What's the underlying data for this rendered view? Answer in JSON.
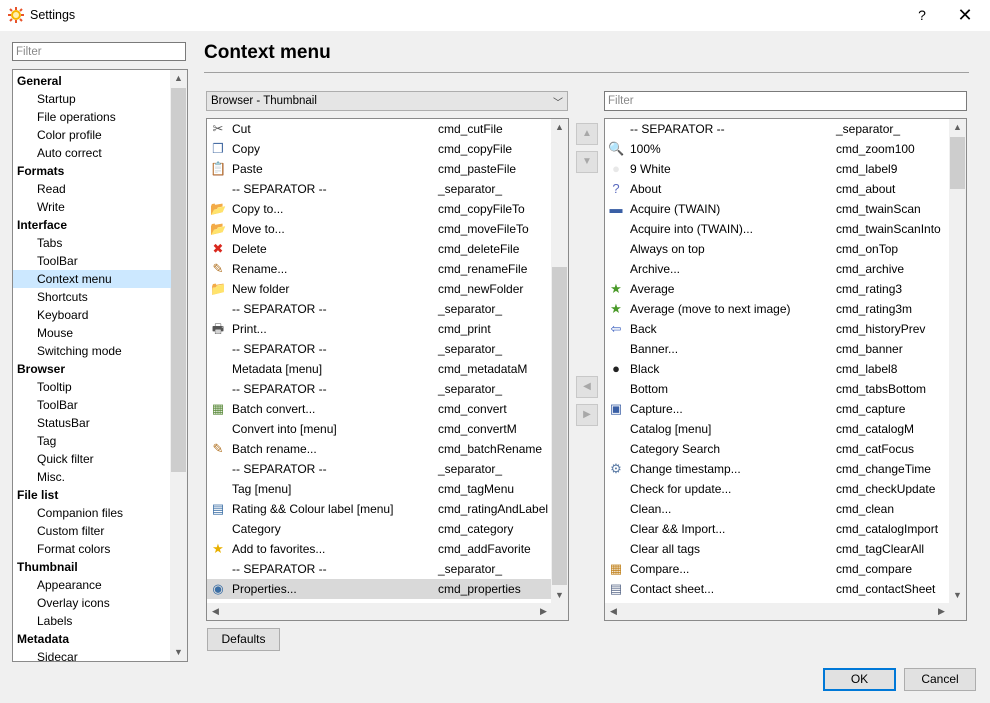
{
  "window": {
    "title": "Settings",
    "help_label": "?",
    "close_label": "✕"
  },
  "sidebar": {
    "filter_placeholder": "Filter",
    "groups": [
      {
        "label": "General",
        "items": [
          "Startup",
          "File operations",
          "Color profile",
          "Auto correct"
        ]
      },
      {
        "label": "Formats",
        "items": [
          "Read",
          "Write"
        ]
      },
      {
        "label": "Interface",
        "items": [
          "Tabs",
          "ToolBar",
          "Context menu",
          "Shortcuts",
          "Keyboard",
          "Mouse",
          "Switching mode"
        ]
      },
      {
        "label": "Browser",
        "items": [
          "Tooltip",
          "ToolBar",
          "StatusBar",
          "Tag",
          "Quick filter",
          "Misc."
        ]
      },
      {
        "label": "File list",
        "items": [
          "Companion files",
          "Custom filter",
          "Format colors"
        ]
      },
      {
        "label": "Thumbnail",
        "items": [
          "Appearance",
          "Overlay icons",
          "Labels"
        ]
      },
      {
        "label": "Metadata",
        "items": [
          "Sidecar"
        ]
      }
    ],
    "selected": "Context menu"
  },
  "main": {
    "heading": "Context menu",
    "menu_select": {
      "value": "Browser - Thumbnail"
    },
    "right_filter_placeholder": "Filter",
    "current_items": [
      {
        "icon": "scissors-icon",
        "glyph": "✂",
        "color": "#555555",
        "name": "Cut",
        "cmd": "cmd_cutFile"
      },
      {
        "icon": "copy-icon",
        "glyph": "❐",
        "color": "#4a6fa5",
        "name": "Copy",
        "cmd": "cmd_copyFile"
      },
      {
        "icon": "paste-icon",
        "glyph": "📋",
        "color": "#8a6d3b",
        "name": "Paste",
        "cmd": "cmd_pasteFile"
      },
      {
        "icon": "",
        "glyph": "",
        "color": "",
        "name": "-- SEPARATOR --",
        "cmd": "_separator_"
      },
      {
        "icon": "copy-to-folder-icon",
        "glyph": "📂",
        "color": "#d4a017",
        "name": "Copy to...",
        "cmd": "cmd_copyFileTo"
      },
      {
        "icon": "move-to-folder-icon",
        "glyph": "📂",
        "color": "#d4a017",
        "name": "Move to...",
        "cmd": "cmd_moveFileTo"
      },
      {
        "icon": "delete-icon",
        "glyph": "✖",
        "color": "#d9281e",
        "name": "Delete",
        "cmd": "cmd_deleteFile"
      },
      {
        "icon": "rename-icon",
        "glyph": "✎",
        "color": "#b07020",
        "name": "Rename...",
        "cmd": "cmd_renameFile"
      },
      {
        "icon": "new-folder-icon",
        "glyph": "📁",
        "color": "#e0b020",
        "name": "New folder",
        "cmd": "cmd_newFolder"
      },
      {
        "icon": "",
        "glyph": "",
        "color": "",
        "name": "-- SEPARATOR --",
        "cmd": "_separator_"
      },
      {
        "icon": "print-icon",
        "glyph": "🖶",
        "color": "#555555",
        "name": "Print...",
        "cmd": "cmd_print"
      },
      {
        "icon": "",
        "glyph": "",
        "color": "",
        "name": "-- SEPARATOR --",
        "cmd": "_separator_"
      },
      {
        "icon": "",
        "glyph": "",
        "color": "",
        "name": "Metadata [menu]",
        "cmd": "cmd_metadataM"
      },
      {
        "icon": "",
        "glyph": "",
        "color": "",
        "name": "-- SEPARATOR --",
        "cmd": "_separator_"
      },
      {
        "icon": "batch-convert-icon",
        "glyph": "▦",
        "color": "#5a8a3a",
        "name": "Batch convert...",
        "cmd": "cmd_convert"
      },
      {
        "icon": "",
        "glyph": "",
        "color": "",
        "name": "Convert into [menu]",
        "cmd": "cmd_convertM"
      },
      {
        "icon": "batch-rename-icon",
        "glyph": "✎",
        "color": "#b07020",
        "name": "Batch rename...",
        "cmd": "cmd_batchRename"
      },
      {
        "icon": "",
        "glyph": "",
        "color": "",
        "name": "-- SEPARATOR --",
        "cmd": "_separator_"
      },
      {
        "icon": "",
        "glyph": "",
        "color": "",
        "name": "Tag [menu]",
        "cmd": "cmd_tagMenu"
      },
      {
        "icon": "rating-icon",
        "glyph": "▤",
        "color": "#3a6ea5",
        "name": "Rating && Colour label [menu]",
        "cmd": "cmd_ratingAndLabel"
      },
      {
        "icon": "",
        "glyph": "",
        "color": "",
        "name": "Category",
        "cmd": "cmd_category"
      },
      {
        "icon": "star-icon",
        "glyph": "★",
        "color": "#e8b000",
        "name": "Add to favorites...",
        "cmd": "cmd_addFavorite"
      },
      {
        "icon": "",
        "glyph": "",
        "color": "",
        "name": "-- SEPARATOR --",
        "cmd": "_separator_"
      },
      {
        "icon": "properties-icon",
        "glyph": "◉",
        "color": "#3a6ea5",
        "name": "Properties...",
        "cmd": "cmd_properties"
      }
    ],
    "selected_current": "Properties...",
    "available_items": [
      {
        "icon": "",
        "glyph": "",
        "color": "",
        "name": "-- SEPARATOR --",
        "cmd": "_separator_"
      },
      {
        "icon": "zoom-icon",
        "glyph": "🔍",
        "color": "#4a6fa5",
        "name": "100%",
        "cmd": "cmd_zoom100"
      },
      {
        "icon": "white-circle-icon",
        "glyph": "●",
        "color": "#e8e8e8",
        "name": "9 White",
        "cmd": "cmd_label9"
      },
      {
        "icon": "about-icon",
        "glyph": "?",
        "color": "#5b6bbf",
        "name": "About",
        "cmd": "cmd_about"
      },
      {
        "icon": "scanner-icon",
        "glyph": "▬",
        "color": "#3a5fa5",
        "name": "Acquire (TWAIN)",
        "cmd": "cmd_twainScan"
      },
      {
        "icon": "",
        "glyph": "",
        "color": "",
        "name": "Acquire into (TWAIN)...",
        "cmd": "cmd_twainScanInto"
      },
      {
        "icon": "",
        "glyph": "",
        "color": "",
        "name": "Always on top",
        "cmd": "cmd_onTop"
      },
      {
        "icon": "",
        "glyph": "",
        "color": "",
        "name": "Archive...",
        "cmd": "cmd_archive"
      },
      {
        "icon": "star-green-icon",
        "glyph": "★",
        "color": "#4a9a2a",
        "name": "Average",
        "cmd": "cmd_rating3"
      },
      {
        "icon": "star-green-arrow-icon",
        "glyph": "★",
        "color": "#4a9a2a",
        "name": "Average (move to next image)",
        "cmd": "cmd_rating3m"
      },
      {
        "icon": "back-icon",
        "glyph": "⇦",
        "color": "#3a5fbf",
        "name": "Back",
        "cmd": "cmd_historyPrev"
      },
      {
        "icon": "",
        "glyph": "",
        "color": "",
        "name": "Banner...",
        "cmd": "cmd_banner"
      },
      {
        "icon": "black-circle-icon",
        "glyph": "●",
        "color": "#222222",
        "name": "Black",
        "cmd": "cmd_label8"
      },
      {
        "icon": "",
        "glyph": "",
        "color": "",
        "name": "Bottom",
        "cmd": "cmd_tabsBottom"
      },
      {
        "icon": "camera-icon",
        "glyph": "▣",
        "color": "#3a5fa5",
        "name": "Capture...",
        "cmd": "cmd_capture"
      },
      {
        "icon": "",
        "glyph": "",
        "color": "",
        "name": "Catalog [menu]",
        "cmd": "cmd_catalogM"
      },
      {
        "icon": "",
        "glyph": "",
        "color": "",
        "name": "Category Search",
        "cmd": "cmd_catFocus"
      },
      {
        "icon": "timestamp-icon",
        "glyph": "⚙",
        "color": "#5a7aa5",
        "name": "Change timestamp...",
        "cmd": "cmd_changeTime"
      },
      {
        "icon": "",
        "glyph": "",
        "color": "",
        "name": "Check for update...",
        "cmd": "cmd_checkUpdate"
      },
      {
        "icon": "",
        "glyph": "",
        "color": "",
        "name": "Clean...",
        "cmd": "cmd_clean"
      },
      {
        "icon": "",
        "glyph": "",
        "color": "",
        "name": "Clear && Import...",
        "cmd": "cmd_catalogImport"
      },
      {
        "icon": "",
        "glyph": "",
        "color": "",
        "name": "Clear all tags",
        "cmd": "cmd_tagClearAll"
      },
      {
        "icon": "compare-icon",
        "glyph": "▦",
        "color": "#c0801a",
        "name": "Compare...",
        "cmd": "cmd_compare"
      },
      {
        "icon": "contact-sheet-icon",
        "glyph": "▤",
        "color": "#5a6a8a",
        "name": "Contact sheet...",
        "cmd": "cmd_contactSheet"
      }
    ]
  },
  "buttons": {
    "defaults": "Defaults",
    "ok": "OK",
    "cancel": "Cancel"
  }
}
